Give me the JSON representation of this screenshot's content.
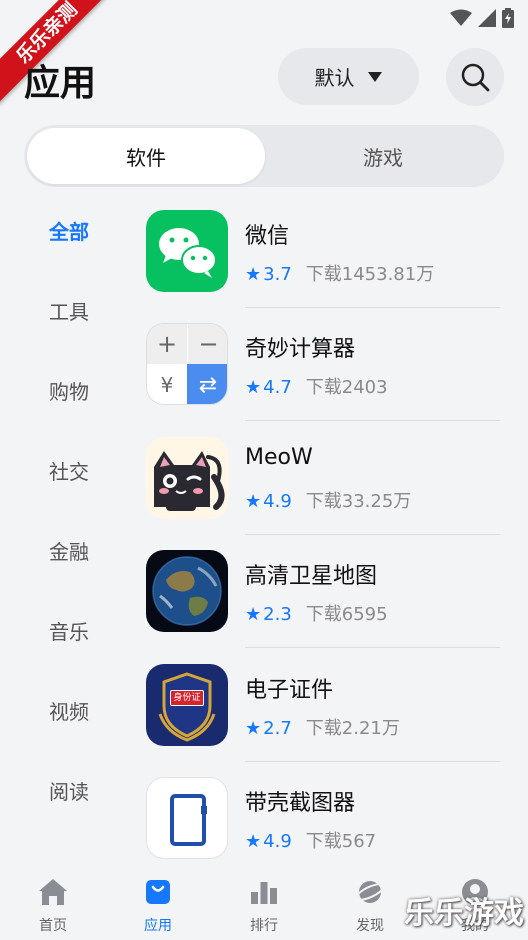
{
  "status_bar": {
    "wifi_icon": "wifi-icon",
    "signal_icon": "signal-icon",
    "battery_icon": "battery-icon"
  },
  "ribbon": {
    "text": "乐乐亲测",
    "color": "#d0121b"
  },
  "header": {
    "title": "应用",
    "sort_label": "默认",
    "sort_icon": "caret-down-icon",
    "search_icon": "search-icon"
  },
  "tabs": [
    {
      "label": "软件",
      "active": true
    },
    {
      "label": "游戏",
      "active": false
    }
  ],
  "categories": [
    {
      "label": "全部",
      "active": true
    },
    {
      "label": "工具"
    },
    {
      "label": "购物"
    },
    {
      "label": "社交"
    },
    {
      "label": "金融"
    },
    {
      "label": "音乐"
    },
    {
      "label": "视频"
    },
    {
      "label": "阅读"
    }
  ],
  "apps": [
    {
      "name": "微信",
      "star": "★",
      "rating": "3.7",
      "downloads": "下载1453.81万",
      "icon": "wechat-icon"
    },
    {
      "name": "奇妙计算器",
      "star": "★",
      "rating": "4.7",
      "downloads": "下载2403",
      "icon": "calculator-icon"
    },
    {
      "name": "MeoW",
      "star": "★",
      "rating": "4.9",
      "downloads": "下载33.25万",
      "icon": "cat-icon"
    },
    {
      "name": "高清卫星地图",
      "star": "★",
      "rating": "2.3",
      "downloads": "下载6595",
      "icon": "earth-icon"
    },
    {
      "name": "电子证件",
      "star": "★",
      "rating": "2.7",
      "downloads": "下载2.21万",
      "icon": "id-badge-icon"
    },
    {
      "name": "带壳截图器",
      "star": "★",
      "rating": "4.9",
      "downloads": "下载567",
      "icon": "phone-frame-icon"
    }
  ],
  "icon_texts": {
    "calc_plus": "+",
    "calc_minus": "−",
    "calc_yen": "¥",
    "calc_swap": "⇄",
    "id_badge": "身份证"
  },
  "bottom_nav": [
    {
      "label": "首页",
      "icon": "home-icon",
      "active": false
    },
    {
      "label": "应用",
      "icon": "bag-icon",
      "active": true
    },
    {
      "label": "排行",
      "icon": "bar-chart-icon",
      "active": false
    },
    {
      "label": "发现",
      "icon": "planet-icon",
      "active": false
    },
    {
      "label": "我的",
      "icon": "user-icon",
      "active": false
    }
  ],
  "watermark": "乐乐游戏",
  "colors": {
    "accent": "#1677ff",
    "background": "#f3f4f6",
    "pill": "#e6e8eb",
    "wechat_green": "#07c160"
  }
}
